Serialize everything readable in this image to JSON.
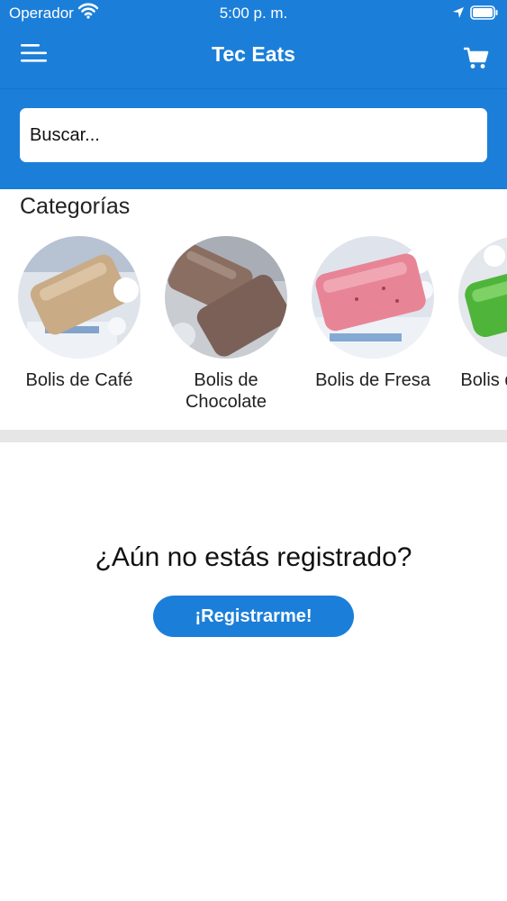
{
  "status_bar": {
    "carrier": "Operador",
    "time": "5:00 p. m."
  },
  "header": {
    "title": "Tec Eats",
    "menu_icon": "menu-icon",
    "cart_icon": "cart-icon"
  },
  "search": {
    "placeholder": "Buscar..."
  },
  "categories": {
    "title": "Categorías",
    "items": [
      {
        "label": "Bolis de Café",
        "image": "coffee-bolis-photo"
      },
      {
        "label": "Bolis de Chocolate",
        "image": "chocolate-bolis-photo"
      },
      {
        "label": "Bolis de Fresa",
        "image": "strawberry-bolis-photo"
      },
      {
        "label": "Bolis de Limón",
        "image": "lime-bolis-photo"
      }
    ]
  },
  "register_prompt": {
    "question": "¿Aún no estás registrado?",
    "button_label": "¡Registrarme!"
  },
  "colors": {
    "primary": "#1b7fd9",
    "separator": "#e6e6e6"
  }
}
